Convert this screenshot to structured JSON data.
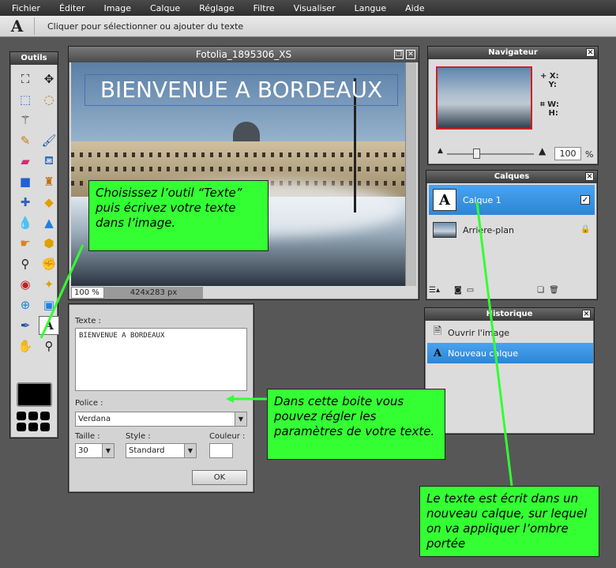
{
  "menu": [
    "Fichier",
    "Éditer",
    "Image",
    "Calque",
    "Réglage",
    "Filtre",
    "Visualiser",
    "Langue",
    "Aide"
  ],
  "options_bar": {
    "tool_glyph": "A",
    "hint": "Cliquer pour sélectionner ou ajouter du texte"
  },
  "tools": {
    "title": "Outils"
  },
  "image_window": {
    "title": "Fotolia_1895306_XS",
    "canvas_text": "BIENVENUE A BORDEAUX",
    "zoom": "100 %",
    "dimensions": "424x283 px"
  },
  "navigator": {
    "title": "Navigateur",
    "x_label": "X:",
    "y_label": "Y:",
    "w_label": "W:",
    "h_label": "H:",
    "zoom_value": "100",
    "zoom_unit": "%"
  },
  "layers": {
    "title": "Calques",
    "items": [
      {
        "name": "Calque 1",
        "thumb": "A",
        "selected": true
      },
      {
        "name": "Arrière-plan",
        "selected": false
      }
    ]
  },
  "history": {
    "title": "Historique",
    "items": [
      {
        "label": "Ouvrir l'image",
        "selected": false
      },
      {
        "label": "Nouveau calque",
        "selected": true
      }
    ]
  },
  "text_dialog": {
    "text_label": "Texte :",
    "text_value": "BIENVENUE A BORDEAUX",
    "font_label": "Police :",
    "font_value": "Verdana",
    "size_label": "Taille :",
    "size_value": "30",
    "style_label": "Style :",
    "style_value": "Standard",
    "color_label": "Couleur :",
    "ok_label": "OK"
  },
  "callouts": {
    "tool": "Choisissez l’outil “Texte” puis écrivez votre texte dans l’image.",
    "dialog": "Dans cette boite vous pouvez régler les paramètres de votre texte.",
    "layer": "Le texte est écrit dans un nouveau calque, sur lequel on va appliquer l’ombre portée"
  },
  "colors": {
    "callout": "#33ff33",
    "selection": "#3a95e6",
    "foreground_swatch": "#000000"
  }
}
